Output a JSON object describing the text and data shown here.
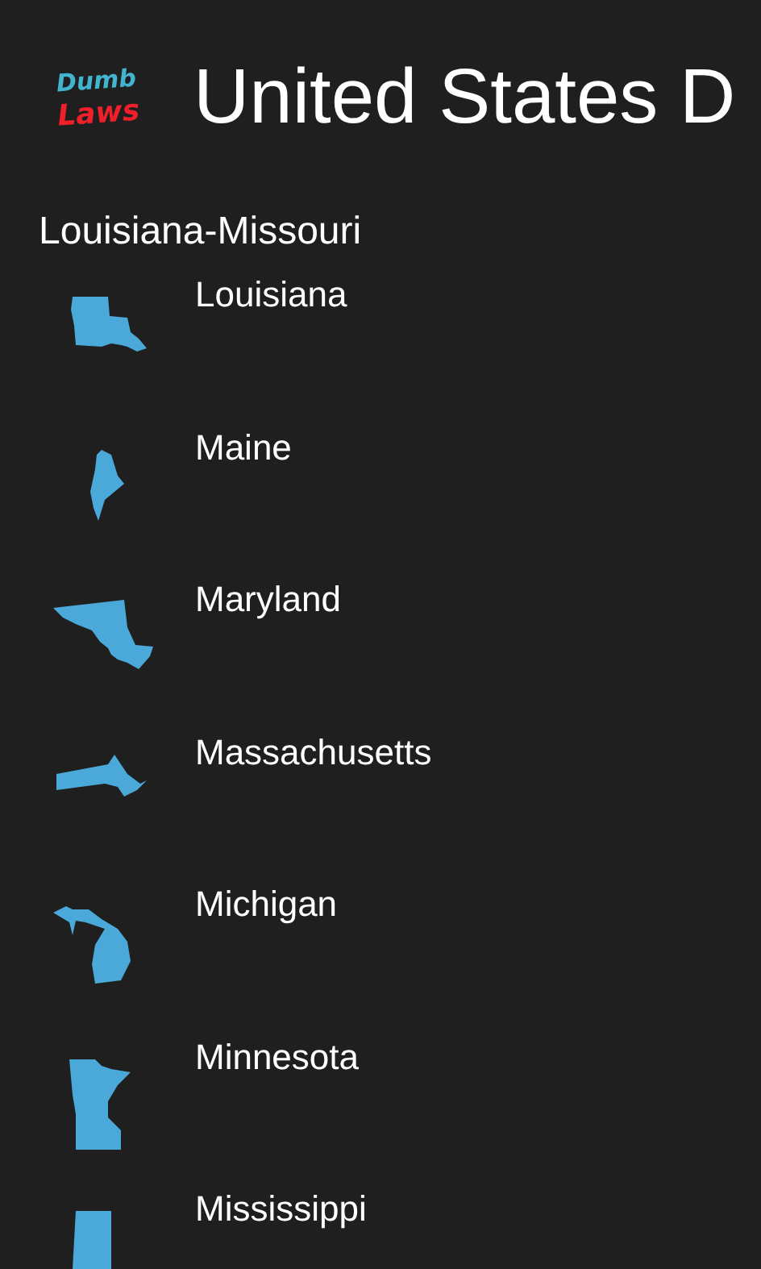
{
  "app_logo": {
    "line_1": "Dumb",
    "line_2": "Laws"
  },
  "page_title": "United States D",
  "group": {
    "title": "Louisiana-Missouri",
    "states": [
      {
        "name": "Louisiana"
      },
      {
        "name": "Maine"
      },
      {
        "name": "Maryland"
      },
      {
        "name": "Massachusetts"
      },
      {
        "name": "Michigan"
      },
      {
        "name": "Minnesota"
      },
      {
        "name": "Mississippi"
      }
    ]
  }
}
